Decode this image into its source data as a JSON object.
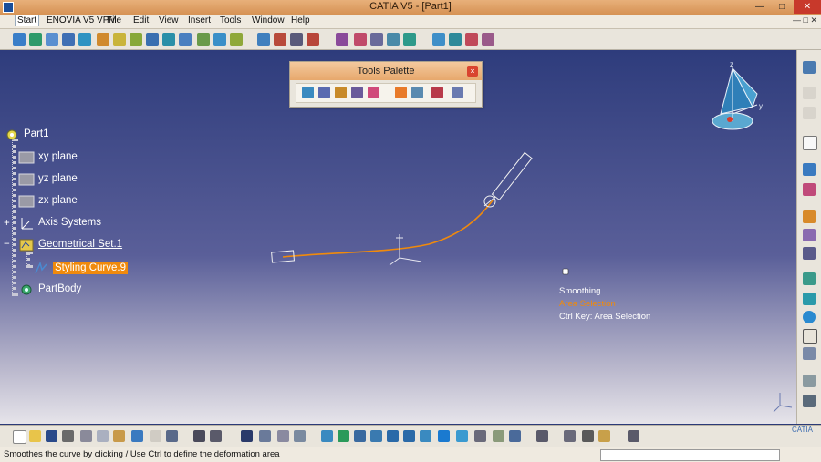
{
  "window": {
    "title": "CATIA V5 - [Part1]"
  },
  "menu": {
    "items": [
      {
        "label": "Start"
      },
      {
        "label": "ENOVIA V5 VPM"
      },
      {
        "label": "File"
      },
      {
        "label": "Edit"
      },
      {
        "label": "View"
      },
      {
        "label": "Insert"
      },
      {
        "label": "Tools"
      },
      {
        "label": "Window"
      },
      {
        "label": "Help"
      }
    ]
  },
  "palette": {
    "title": "Tools Palette",
    "close_label": "×"
  },
  "tree": {
    "root": "Part1",
    "nodes": [
      {
        "label": "xy plane"
      },
      {
        "label": "yz plane"
      },
      {
        "label": "zx plane"
      },
      {
        "label": "Axis Systems"
      },
      {
        "label": "Geometrical Set.1"
      },
      {
        "label": "Styling Curve.9"
      },
      {
        "label": "PartBody"
      }
    ]
  },
  "hint": {
    "line1": "Smoothing",
    "line2": "Area Selection",
    "line3": "Ctrl Key: Area Selection",
    "line2_color": "#f08a0c"
  },
  "compass_labels": {
    "z": "z",
    "y": "y"
  },
  "logo": "CATIA",
  "status": {
    "text": "Smoothes the curve by clicking / Use Ctrl to define the deformation area"
  },
  "colors": {
    "selection": "#f08a0c",
    "curve": "#f08a0c"
  }
}
